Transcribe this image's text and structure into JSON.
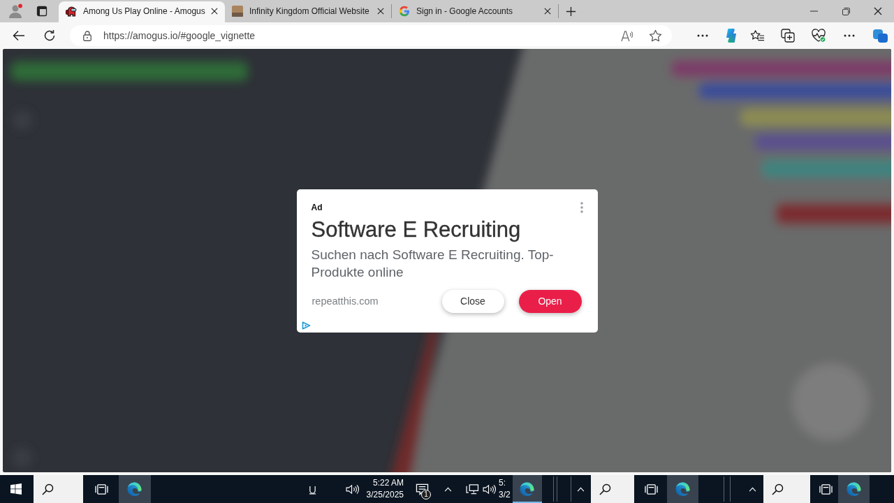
{
  "browser": {
    "tabs": [
      {
        "title": "Among Us Play Online - Amogus",
        "selected": true
      },
      {
        "title": "Infinity Kingdom Official Website",
        "selected": false
      },
      {
        "title": "Sign in - Google Accounts",
        "selected": false
      }
    ],
    "address": "https://amogus.io/#google_vignette"
  },
  "ad": {
    "label": "Ad",
    "title": "Software E Recruiting",
    "description": "Suchen nach Software E Recruiting. Top-Produkte online",
    "domain": "repeatthis.com",
    "buttons": [
      {
        "label": "Close",
        "kind": "secondary"
      },
      {
        "label": "Open",
        "kind": "primary"
      }
    ]
  },
  "taskbar": {
    "clocks": [
      {
        "time": "5:22 AM",
        "date": "3/25/2025"
      },
      {
        "time": "5:",
        "date": "3/2"
      }
    ],
    "notification_count": "1"
  }
}
